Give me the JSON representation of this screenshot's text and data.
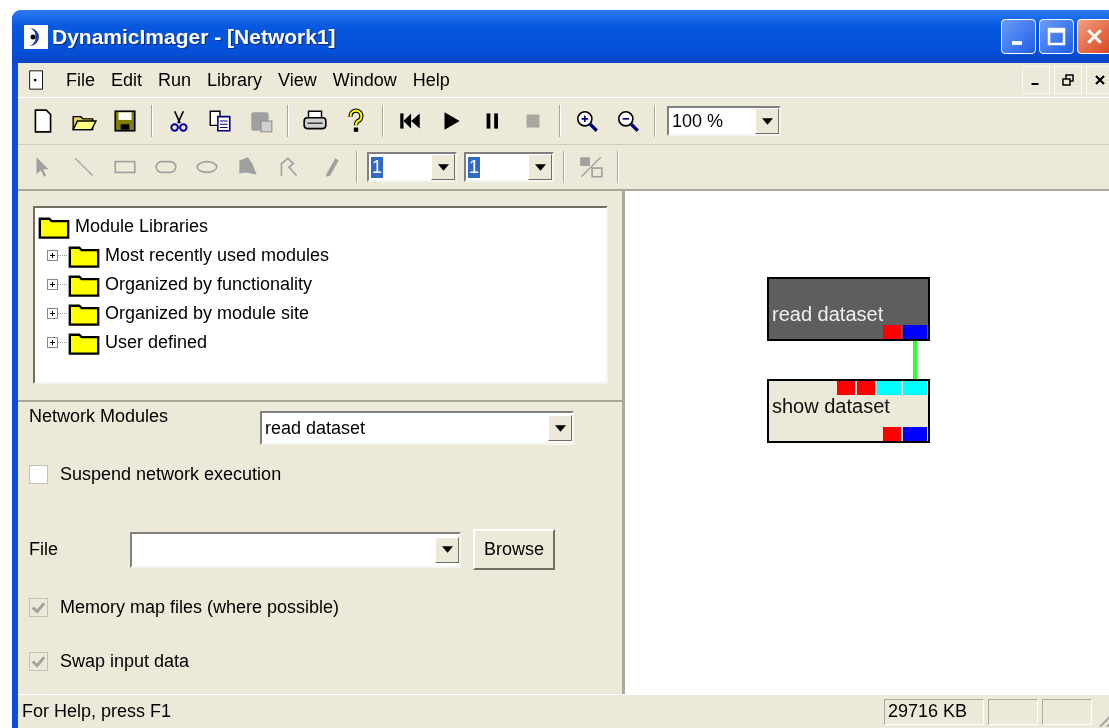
{
  "window": {
    "title": "DynamicImager - [Network1]"
  },
  "menu": [
    "File",
    "Edit",
    "Run",
    "Library",
    "View",
    "Window",
    "Help"
  ],
  "toolbar": {
    "zoom": "100 %"
  },
  "draw_toolbar": {
    "combos": [
      {
        "value": "1",
        "text_selected": true
      },
      {
        "value": "1",
        "text_selected": true
      }
    ]
  },
  "module_tree": {
    "label": "Module Libraries",
    "children": [
      {
        "label": "Most recently used modules",
        "expanded": false
      },
      {
        "label": "Organized by functionality",
        "expanded": false
      },
      {
        "label": "Organized by module site",
        "expanded": false
      },
      {
        "label": "User defined",
        "expanded": false
      }
    ]
  },
  "properties": {
    "network_modules_label": "Network Modules",
    "network_module": "read dataset",
    "suspend": {
      "label": "Suspend network execution",
      "checked": false,
      "disabled": false
    },
    "file_label": "File",
    "browse": "Browse",
    "options": [
      {
        "label": "Memory map files (where possible)",
        "checked": true,
        "disabled": true
      },
      {
        "label": "Swap input data",
        "checked": true,
        "disabled": true
      }
    ]
  },
  "canvas": {
    "nodes": [
      {
        "label": "read dataset",
        "selected": true,
        "outputs": [
          {
            "kind": "param",
            "color": "#ff0000"
          },
          {
            "kind": "data",
            "color": "#0000ff"
          }
        ]
      },
      {
        "label": "show dataset",
        "selected": false,
        "inputs": [
          {
            "kind": "param",
            "color": "#ff0000",
            "connected": false
          },
          {
            "kind": "param",
            "color": "#ff0000",
            "connected": false
          },
          {
            "kind": "data",
            "color": "#00ffff",
            "connected": false
          },
          {
            "kind": "data",
            "color": "#00ffff",
            "connected": true
          }
        ],
        "outputs": [
          {
            "kind": "param",
            "color": "#ff0000"
          },
          {
            "kind": "data",
            "color": "#0000ff"
          }
        ]
      }
    ]
  },
  "status_bar": {
    "text": "For Help, press F1",
    "memory": "29716 KB"
  }
}
